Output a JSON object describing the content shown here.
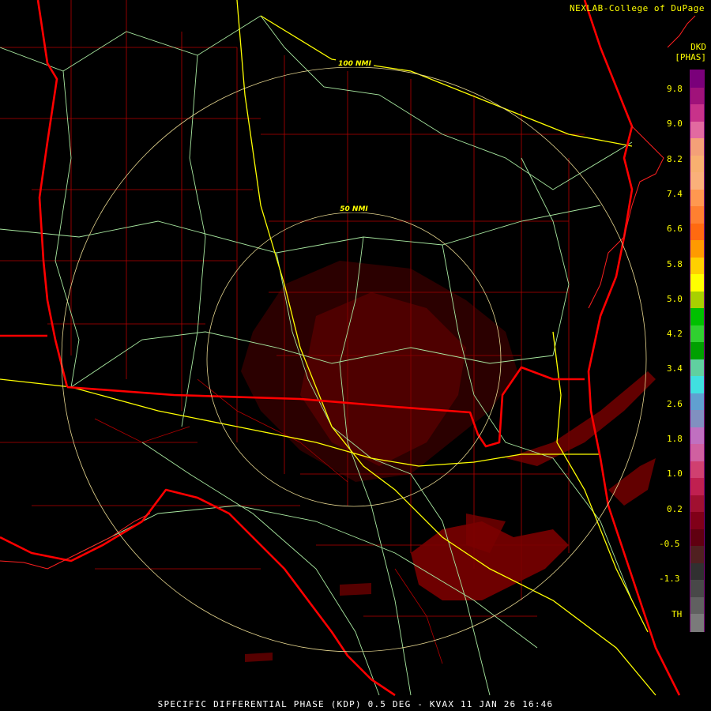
{
  "header": {
    "credit": "NEXLAB-College of DuPage",
    "product_code": "DKD",
    "units": "[PHAS]"
  },
  "footer": {
    "caption": "SPECIFIC DIFFERENTIAL PHASE (KDP) 0.5 DEG - KVAX 11 JAN 26 16:46"
  },
  "range_rings": {
    "inner_label": "50 NMI",
    "outer_label": "100 NMI"
  },
  "colorbar": {
    "labels": [
      "9.8",
      "9.0",
      "8.2",
      "7.4",
      "6.6",
      "5.8",
      "5.0",
      "4.2",
      "3.4",
      "2.6",
      "1.8",
      "1.0",
      "0.2",
      "-0.5",
      "-1.3",
      "TH"
    ],
    "colors": [
      "#7a007a",
      "#a0127a",
      "#c8328a",
      "#e26aa0",
      "#f4a078",
      "#f8b070",
      "#fab07a",
      "#ff9850",
      "#ff8030",
      "#ff6a10",
      "#ff9a00",
      "#ffd000",
      "#ffff00",
      "#a8d000",
      "#00c000",
      "#30d030",
      "#00a000",
      "#60d0a0",
      "#40e0e0",
      "#60a0d0",
      "#8090c0",
      "#c070c0",
      "#d060a0",
      "#d04070",
      "#c02050",
      "#a01030",
      "#800018",
      "#600010",
      "#502020",
      "#303030",
      "#484848",
      "#606060",
      "#7a7a7a"
    ]
  },
  "map": {
    "colors": {
      "background": "#000000",
      "state_lines": "#ff0000",
      "county_lines": "#b40000",
      "highways_major": "#ffff00",
      "highways_minor": "#a8e8a0",
      "range_rings": "#e8d890",
      "echo": "#7a0000"
    }
  }
}
